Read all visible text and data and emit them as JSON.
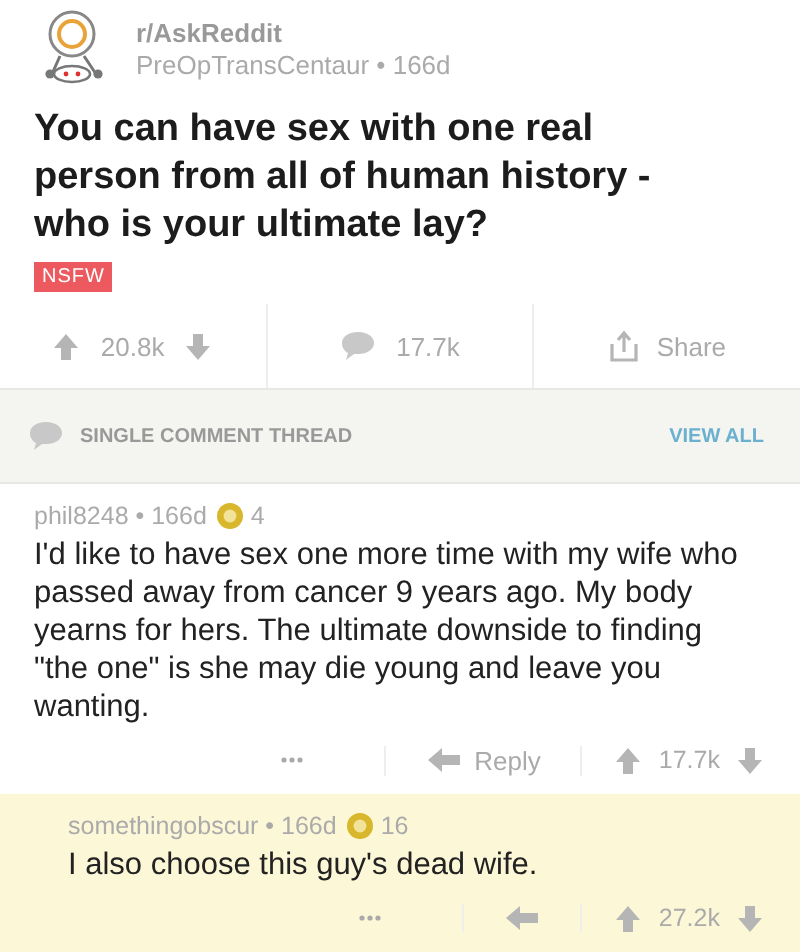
{
  "post": {
    "subreddit": "r/AskReddit",
    "meta": "PreOpTransCentaur • 166d",
    "title": "You can have sex with one real person from all of human history - who is your ultimate lay?",
    "tag": "NSFW"
  },
  "actions": {
    "score": "20.8k",
    "comments": "17.7k",
    "share": "Share"
  },
  "thread_bar": {
    "label": "SINGLE COMMENT THREAD",
    "link": "VIEW ALL"
  },
  "comments": [
    {
      "meta": "phil8248 • 166d",
      "gilded": "4",
      "highlighted": false,
      "body": "I'd like to have sex one more time with my wife who passed away from cancer 9 years ago.  My body yearns for hers.  The ultimate downside to finding \"the one\" is she may die young and leave you wanting.",
      "reply": "Reply",
      "score": "17.7k",
      "children": [
        {
          "meta": "somethingobscur • 166d",
          "gilded": "16",
          "highlighted": true,
          "body": "I also choose this guy's dead wife.",
          "score": "27.2k"
        }
      ]
    }
  ]
}
